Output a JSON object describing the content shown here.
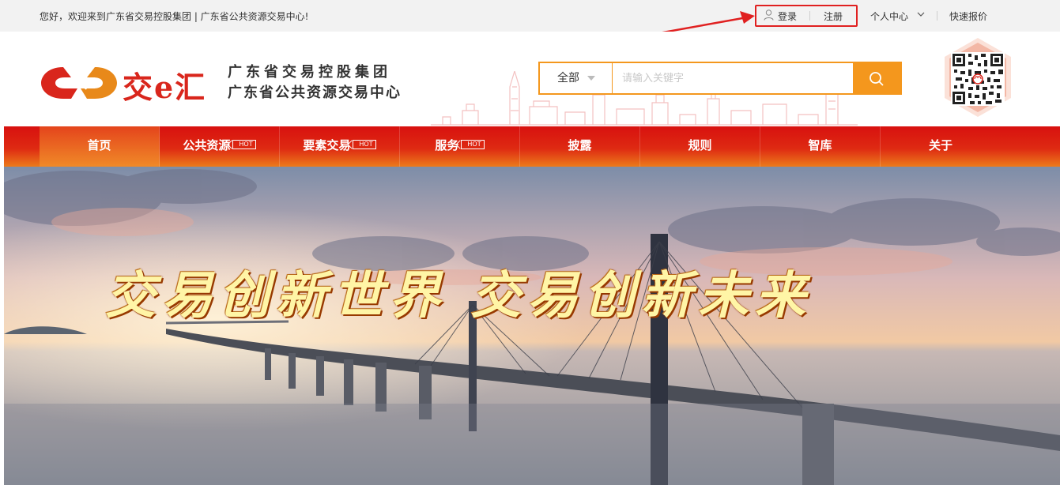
{
  "topbar": {
    "welcome": "您好，欢迎来到广东省交易控股集团 | 广东省公共资源交易中心!",
    "login": "登录",
    "register": "注册",
    "user_center": "个人中心",
    "quick_quote": "快速报价"
  },
  "header": {
    "logo_text": "交e汇",
    "org_line1": "广东省交易控股集团",
    "org_line2": "广东省公共资源交易中心",
    "search_scope": "全部",
    "search_placeholder": "请输入关键字"
  },
  "nav": {
    "items": [
      {
        "label": "首页",
        "hot": ""
      },
      {
        "label": "公共资源",
        "hot": "HOT"
      },
      {
        "label": "要素交易",
        "hot": "HOT"
      },
      {
        "label": "服务",
        "hot": "HOT"
      },
      {
        "label": "披露",
        "hot": ""
      },
      {
        "label": "规则",
        "hot": ""
      },
      {
        "label": "智库",
        "hot": ""
      },
      {
        "label": "关于",
        "hot": ""
      }
    ]
  },
  "banner": {
    "slogan": "交易创新世界  交易创新未来"
  },
  "colors": {
    "brand_red": "#d9261c",
    "accent_orange": "#f4971d",
    "highlight_box": "#e02020"
  }
}
